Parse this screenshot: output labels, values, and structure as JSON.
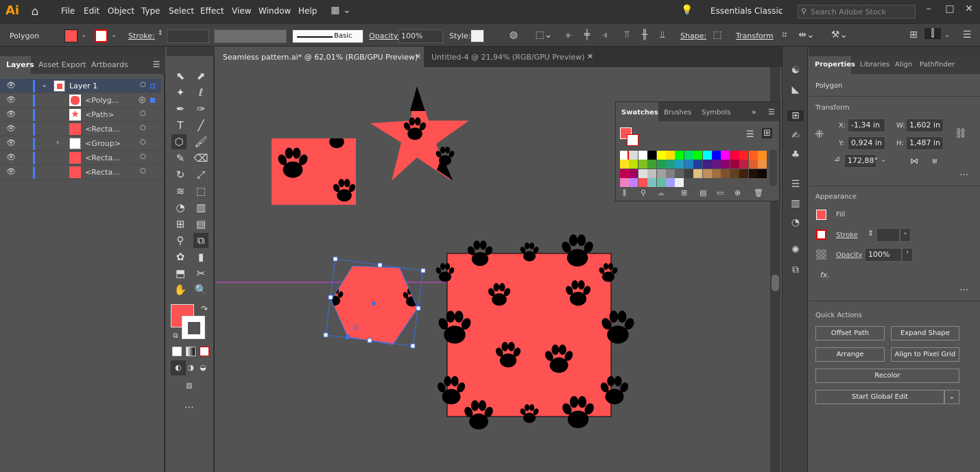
{
  "app": {
    "logo": "Ai"
  },
  "menu": [
    "File",
    "Edit",
    "Object",
    "Type",
    "Select",
    "Effect",
    "View",
    "Window",
    "Help"
  ],
  "workspace": "Essentials Classic",
  "search_placeholder": "Search Adobe Stock",
  "control": {
    "object_type": "Polygon",
    "stroke_label": "Stroke:",
    "brush_label": "Basic",
    "opacity_label": "Opacity:",
    "opacity_value": "100%",
    "style_label": "Style:",
    "shape_label": "Shape:",
    "transform_label": "Transform"
  },
  "left_tabs": [
    "Layers",
    "Asset Export",
    "Artboards"
  ],
  "layers": [
    {
      "name": "Layer 1"
    },
    {
      "name": "<Polyg..."
    },
    {
      "name": "<Path>"
    },
    {
      "name": "<Recta..."
    },
    {
      "name": "<Group>"
    },
    {
      "name": "<Recta..."
    },
    {
      "name": "<Recta..."
    }
  ],
  "doc_tabs": [
    {
      "title": "Seamless pattern.ai* @ 62,01% (RGB/GPU Preview)"
    },
    {
      "title": "Untitled-4 @ 21,94% (RGB/GPU Preview)"
    }
  ],
  "swatches_panel": {
    "tabs": [
      "Swatches",
      "Brushes",
      "Symbols"
    ]
  },
  "properties": {
    "tabs": [
      "Properties",
      "Libraries",
      "Align",
      "Pathfinder"
    ],
    "object": "Polygon",
    "transform_title": "Transform",
    "x_label": "X:",
    "x": "-1,34 in",
    "y_label": "Y:",
    "y": "0,924 in",
    "w_label": "W:",
    "w": "1,602 in",
    "h_label": "H:",
    "h": "1,487 in",
    "angle": "172,88°",
    "appearance_title": "Appearance",
    "fill_label": "Fill",
    "stroke_label": "Stroke",
    "opacity_label": "Opacity",
    "opacity_value": "100%",
    "fx_label": "fx.",
    "quick_actions_title": "Quick Actions",
    "buttons": {
      "offset_path": "Offset Path",
      "expand_shape": "Expand Shape",
      "arrange": "Arrange",
      "align_pixel": "Align to Pixel Grid",
      "recolor": "Recolor",
      "global_edit": "Start Global Edit"
    }
  },
  "colors": {
    "pattern_fill": "#ff5252",
    "selection": "#3c6fe0",
    "accent_orange": "#ff8a00"
  }
}
